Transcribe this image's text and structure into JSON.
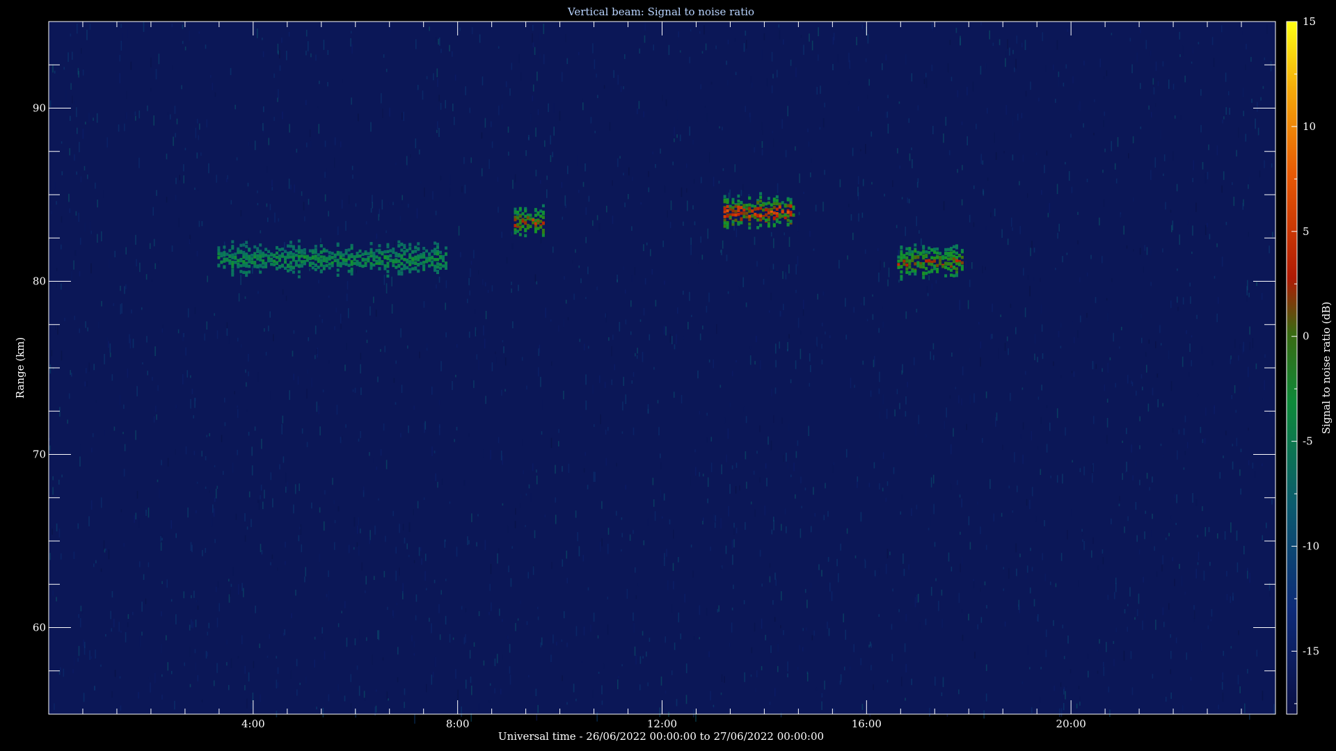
{
  "chart_data": {
    "type": "heatmap",
    "title": "Vertical beam: Signal to noise ratio",
    "xlabel": "Universal time - 26/06/2022 00:00:00 to 27/06/2022 00:00:00",
    "ylabel": "Range (km)",
    "x_unit": "hour UT",
    "xlim": [
      0,
      24
    ],
    "ylim": [
      55,
      95
    ],
    "x_ticks": [
      4,
      8,
      12,
      16,
      20
    ],
    "x_tick_labels": [
      "4:00",
      "8:00",
      "12:00",
      "16:00",
      "20:00"
    ],
    "y_ticks": [
      60,
      70,
      80,
      90
    ],
    "y_tick_labels": [
      "60",
      "70",
      "80",
      "90"
    ],
    "colorbar": {
      "label": "Signal to noise ratio (dB)",
      "range": [
        -18,
        15
      ],
      "ticks": [
        -15,
        -10,
        -5,
        0,
        5,
        10,
        15
      ],
      "tick_labels": [
        "-15",
        "-10",
        "-5",
        "0",
        "5",
        "10",
        "15"
      ],
      "position": "right"
    },
    "background_level_db": -16,
    "echoes": [
      {
        "start_hour": 3.3,
        "end_hour": 7.8,
        "range_km": 81.3,
        "peak_db": -5
      },
      {
        "start_hour": 9.1,
        "end_hour": 9.7,
        "range_km": 83.5,
        "peak_db": 3
      },
      {
        "start_hour": 13.2,
        "end_hour": 14.6,
        "range_km": 84.0,
        "peak_db": 6
      },
      {
        "start_hour": 16.6,
        "end_hour": 17.9,
        "range_km": 81.2,
        "peak_db": 2
      }
    ]
  }
}
